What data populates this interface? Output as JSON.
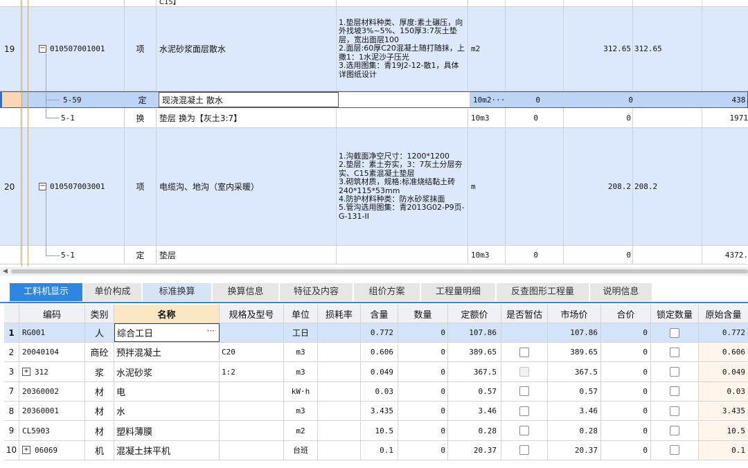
{
  "upper_grid": {
    "partial_top_text": "C15】",
    "rows": [
      {
        "num": "19",
        "code": "010507001001",
        "type": "项",
        "name": "水泥砂浆面层散水",
        "features": "1.垫层材料种类、厚度:素土碾压，向外找坡3%~5%、150厚3:7灰土垫层，宽出面层100\n2.面层:60厚C20混凝土随打随抹，上撒1：1水泥沙子压光\n3.选用图集：青19J2-12-散1，具体详图纸设计",
        "unit": "m2",
        "q1": "",
        "q2": "312.65",
        "q3": "312.65",
        "q4": ""
      },
      {
        "num": "",
        "code": "5-59",
        "type": "定",
        "name": "现浇混凝土 散水",
        "features": "",
        "unit": "10m2···",
        "q1": "0",
        "q2": "0",
        "q3": "",
        "q4": "438."
      },
      {
        "num": "",
        "code": "5-1",
        "type": "换",
        "name": "垫层  换为【灰土3:7】",
        "features": "",
        "unit": "10m3",
        "q1": "0",
        "q2": "0",
        "q3": "",
        "q4": "1971"
      },
      {
        "num": "20",
        "code": "010507003001",
        "type": "项",
        "name": "电缆沟、地沟（室内采暖）",
        "features": "1.沟截面净空尺寸：1200*1200\n2.垫层：素土夯实，3：7灰土分层夯实、C15素混凝土垫层\n3.砌筑材质，规格:标准烧结黏土砖240*115*53mm\n4.防护材料种类：防水砂浆抹面\n5.管沟选用图集：青2013G02-P9页-G-131-II",
        "unit": "m",
        "q1": "",
        "q2": "208.2",
        "q3": "208.2",
        "q4": ""
      },
      {
        "num": "",
        "code": "5-1",
        "type": "定",
        "name": "垫层",
        "features": "",
        "unit": "10m3",
        "q1": "0",
        "q2": "0",
        "q3": "",
        "q4": "4372."
      }
    ]
  },
  "tabs": [
    {
      "label": "工料机显示",
      "active": true
    },
    {
      "label": "单价构成",
      "active": false
    },
    {
      "label": "标准换算",
      "active": false
    },
    {
      "label": "换算信息",
      "active": false
    },
    {
      "label": "特征及内容",
      "active": false
    },
    {
      "label": "组价方案",
      "active": false
    },
    {
      "label": "工程量明细",
      "active": false
    },
    {
      "label": "反查图形工程量",
      "active": false
    },
    {
      "label": "说明信息",
      "active": false
    }
  ],
  "lower_grid": {
    "headers": {
      "code": "编码",
      "category": "类别",
      "name": "名称",
      "spec": "规格及型号",
      "unit": "单位",
      "loss": "损耗率",
      "content": "含量",
      "quantity": "数量",
      "quota_price": "定额价",
      "provisional": "是否暂估",
      "market_price": "市场价",
      "total_price": "合价",
      "lock_qty": "锁定数量",
      "orig_content": "原始含量"
    },
    "rows": [
      {
        "idx": "1",
        "code": "RG001",
        "category": "人",
        "name": "综合工日",
        "spec": "",
        "unit": "工日",
        "content": "0.772",
        "quantity": "0",
        "quota_price": "107.86",
        "provisional": "none",
        "market_price": "107.86",
        "total_price": "0",
        "orig_content": "0.772",
        "expand": false
      },
      {
        "idx": "2",
        "code": "20040104",
        "category": "商砼",
        "name": "预拌混凝土",
        "spec": "C20",
        "unit": "m3",
        "content": "0.606",
        "quantity": "0",
        "quota_price": "389.65",
        "provisional": "checkbox",
        "market_price": "389.65",
        "total_price": "0",
        "orig_content": "0.606",
        "expand": false
      },
      {
        "idx": "3",
        "code": "312",
        "category": "浆",
        "name": "水泥砂浆",
        "spec": "1:2",
        "unit": "m3",
        "content": "0.049",
        "quantity": "0",
        "quota_price": "367.5",
        "provisional": "disabled",
        "market_price": "367.5",
        "total_price": "0",
        "orig_content": "0.049",
        "expand": true
      },
      {
        "idx": "7",
        "code": "20360002",
        "category": "材",
        "name": "电",
        "spec": "",
        "unit": "kW·h",
        "content": "0.03",
        "quantity": "0",
        "quota_price": "0.57",
        "provisional": "checkbox",
        "market_price": "0.57",
        "total_price": "0",
        "orig_content": "0.03",
        "expand": false
      },
      {
        "idx": "8",
        "code": "20360001",
        "category": "材",
        "name": "水",
        "spec": "",
        "unit": "m3",
        "content": "3.435",
        "quantity": "0",
        "quota_price": "3.46",
        "provisional": "checkbox",
        "market_price": "3.46",
        "total_price": "0",
        "orig_content": "3.435",
        "expand": false
      },
      {
        "idx": "9",
        "code": "CL5903",
        "category": "材",
        "name": "塑料薄膜",
        "spec": "",
        "unit": "m2",
        "content": "10.5",
        "quantity": "0",
        "quota_price": "0.28",
        "provisional": "checkbox",
        "market_price": "0.28",
        "total_price": "0",
        "orig_content": "10.5",
        "expand": false
      },
      {
        "idx": "10",
        "code": "06069",
        "category": "机",
        "name": "混凝土抹平机",
        "spec": "",
        "unit": "台班",
        "content": "0.1",
        "quantity": "0",
        "quota_price": "20.37",
        "provisional": "checkbox",
        "market_price": "20.37",
        "total_price": "0",
        "orig_content": "0.1",
        "expand": true
      }
    ],
    "edit_button": "···",
    "expand_symbol": "+",
    "collapse_symbol": "−"
  },
  "scroll_left_arrow": "◀",
  "colors": {
    "accent": "#2f86e0",
    "row_blue": "#dce8fb",
    "selected": "#bcd4f5",
    "name_header": "#fbe7c4"
  }
}
